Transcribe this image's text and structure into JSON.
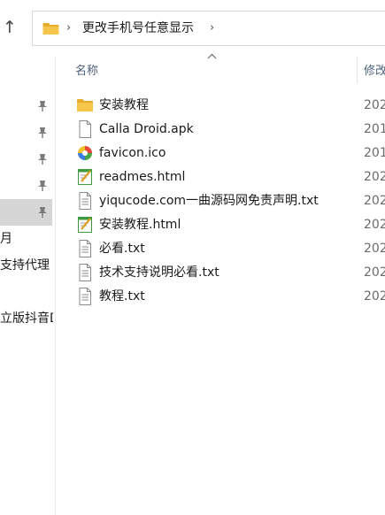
{
  "address_bar": {
    "path": "更改手机号任意显示"
  },
  "navigation": {
    "items": [
      {
        "label": ""
      },
      {
        "label": ""
      },
      {
        "label": ""
      },
      {
        "label": ""
      },
      {
        "label": ""
      },
      {
        "label": "月"
      },
      {
        "label": "支持代理"
      },
      {
        "label": ""
      },
      {
        "label": "立版抖音D"
      }
    ]
  },
  "columns": {
    "name": "名称",
    "date": "修改"
  },
  "files": [
    {
      "name": "安装教程",
      "date": "202",
      "icon": "folder-icon"
    },
    {
      "name": "Calla Droid.apk",
      "date": "201",
      "icon": "blank-file-icon"
    },
    {
      "name": "favicon.ico",
      "date": "201",
      "icon": "colorful-ball-icon"
    },
    {
      "name": "readmes.html",
      "date": "202",
      "icon": "html-file-icon"
    },
    {
      "name": "yiqucode.com一曲源码网免责声明.txt",
      "date": "202",
      "icon": "text-file-icon"
    },
    {
      "name": "安装教程.html",
      "date": "202",
      "icon": "html-file-icon"
    },
    {
      "name": "必看.txt",
      "date": "202",
      "icon": "text-file-icon"
    },
    {
      "name": "技术支持说明必看.txt",
      "date": "202",
      "icon": "text-file-icon"
    },
    {
      "name": "教程.txt",
      "date": "202",
      "icon": "text-file-icon"
    }
  ],
  "colors": {
    "folder": "#f6c64a",
    "selection": "#d6d6d6",
    "header_text": "#4c607a"
  }
}
